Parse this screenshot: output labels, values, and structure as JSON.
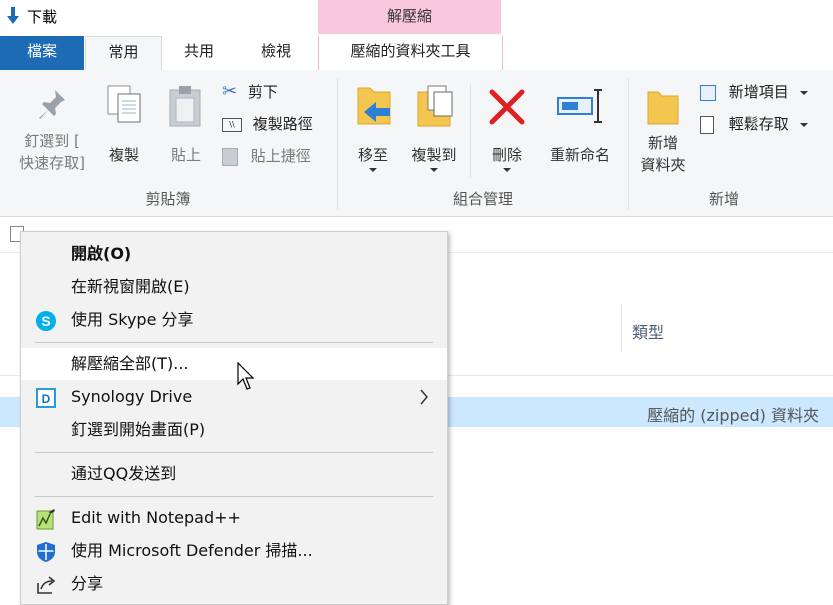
{
  "titlebar": {
    "title": "下載"
  },
  "ribbon_context_tab": {
    "label": "解壓縮"
  },
  "tabs": {
    "file": "檔案",
    "home": "常用",
    "share": "共用",
    "view": "檢視",
    "compressed_tools": "壓縮的資料夾工具"
  },
  "clipboard": {
    "pin_label": "釘選到 [\n快速存取]",
    "copy_label": "複製",
    "paste_label": "貼上",
    "cut_label": "剪下",
    "copy_path_label": "複製路徑",
    "paste_shortcut_label": "貼上捷徑",
    "group_label": "剪貼簿"
  },
  "organize": {
    "move_to_label": "移至",
    "copy_to_label": "複製到",
    "delete_label": "刪除",
    "rename_label": "重新命名",
    "group_label": "組合管理"
  },
  "new_group": {
    "new_folder_label": "新增\n資料夾",
    "new_item_label": "新增項目",
    "easy_access_label": "輕鬆存取",
    "group_label": "新增"
  },
  "file_list": {
    "type_header": "類型",
    "selected_row_type": "壓縮的 (zipped) 資料夾"
  },
  "context_menu": {
    "open": "開啟(O)",
    "open_new_window": "在新視窗開啟(E)",
    "skype_share": "使用 Skype 分享",
    "extract_all": "解壓縮全部(T)...",
    "synology_drive": "Synology Drive",
    "pin_start": "釘選到開始畫面(P)",
    "send_qq": "通过QQ发送到",
    "notepad": "Edit with Notepad++",
    "defender": "使用 Microsoft Defender 掃描...",
    "share": "分享"
  },
  "colors": {
    "file_tab_bg": "#1d6ab5",
    "context_tab_bg": "#f9c8dd",
    "selection_bg": "#cce8ff",
    "menu_hover_bg": "#ffffff"
  }
}
